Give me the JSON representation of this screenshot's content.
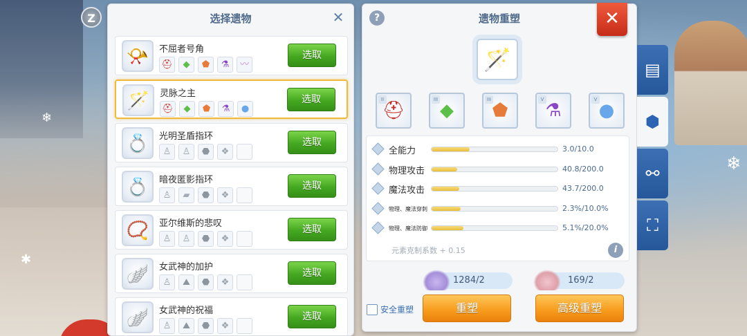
{
  "left_panel": {
    "title": "选择遗物",
    "pick_label": "选取",
    "relics": [
      {
        "name": "不屈者号角",
        "icon": "horn-icon",
        "slots": [
          "helmet-icon",
          "gem-green-icon",
          "stone-orange-icon",
          "flask-purple-icon",
          "wings-icon"
        ]
      },
      {
        "name": "灵脉之主",
        "icon": "staff-icon",
        "selected": true,
        "slots": [
          "helmet-icon",
          "gem-green-icon",
          "stone-orange-icon",
          "flask-purple-icon",
          "orb-blue-icon"
        ]
      },
      {
        "name": "光明圣盾指环",
        "icon": "ring-icon",
        "slots": [
          "statue-icon",
          "statue-icon",
          "stone-gray-icon",
          "crystal-gray-icon",
          ""
        ]
      },
      {
        "name": "暗夜匿影指环",
        "icon": "ring-icon",
        "slots": [
          "statue-icon",
          "slab-icon",
          "stone-gray-icon",
          "crystal-gray-icon",
          ""
        ]
      },
      {
        "name": "亚尔维斯的悲叹",
        "icon": "amulet-icon",
        "slots": [
          "statue-icon",
          "statue-icon",
          "stone-gray-icon",
          "crystal-gray-icon",
          ""
        ]
      },
      {
        "name": "女武神的加护",
        "icon": "wing-helm-icon",
        "slots": [
          "statue-icon",
          "rock-icon",
          "stone-gray-icon",
          "crystal-gray-icon",
          ""
        ]
      },
      {
        "name": "女武神的祝福",
        "icon": "wing-helm-icon",
        "slots": [
          "statue-icon",
          "rock-icon",
          "stone-gray-icon",
          "crystal-gray-icon",
          ""
        ]
      }
    ]
  },
  "right_panel": {
    "title": "遗物重塑",
    "help_icon": "question-icon",
    "main_relic_icon": "staff-icon",
    "runes": [
      {
        "roman": "II",
        "icon": "helmet-icon"
      },
      {
        "roman": "III",
        "icon": "gem-green-icon"
      },
      {
        "roman": "III",
        "icon": "stone-orange-icon"
      },
      {
        "roman": "V",
        "icon": "flask-purple-icon"
      },
      {
        "roman": "V",
        "icon": "orb-blue-icon"
      }
    ],
    "stats": [
      {
        "name": "全能力",
        "value": "3.0/10.0",
        "fill": 0.3,
        "small": false
      },
      {
        "name": "物理攻击",
        "value": "40.8/200.0",
        "fill": 0.204,
        "small": false
      },
      {
        "name": "魔法攻击",
        "value": "43.7/200.0",
        "fill": 0.2185,
        "small": false
      },
      {
        "name": "物理、魔法穿刺",
        "value": "2.3%/10.0%",
        "fill": 0.23,
        "small": true
      },
      {
        "name": "物理、魔法防御",
        "value": "5.1%/20.0%",
        "fill": 0.255,
        "small": true
      }
    ],
    "element_coefficient": "元素克制系数 + 0.15",
    "materials": [
      {
        "amount": "1284/2",
        "color": "purple"
      },
      {
        "amount": "169/2",
        "color": "pink"
      }
    ],
    "safe_reshape_label": "安全重塑",
    "reshape_label": "重塑",
    "advanced_reshape_label": "高级重塑"
  },
  "side_tabs": [
    {
      "icon": "shop-icon"
    },
    {
      "icon": "cubes-icon",
      "active": true
    },
    {
      "icon": "nodes-icon"
    },
    {
      "icon": "frame-icon"
    }
  ],
  "colors": {
    "accent_green": "#45a821",
    "accent_orange": "#f79a1b",
    "selected_border": "#f0b93a",
    "close_red": "#d63a22",
    "tab_blue": "#2f63a8"
  }
}
